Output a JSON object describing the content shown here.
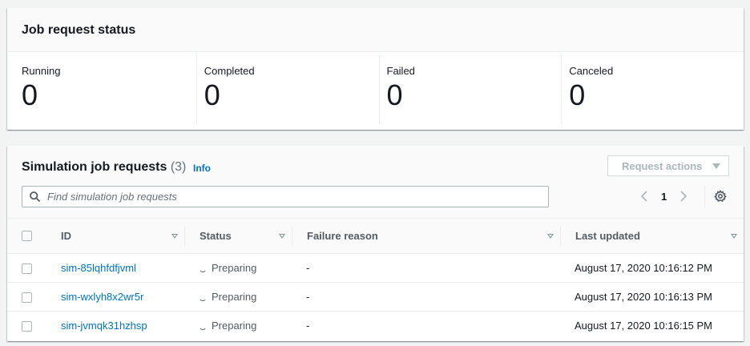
{
  "status_panel": {
    "title": "Job request status",
    "stats": [
      {
        "label": "Running",
        "value": "0"
      },
      {
        "label": "Completed",
        "value": "0"
      },
      {
        "label": "Failed",
        "value": "0"
      },
      {
        "label": "Canceled",
        "value": "0"
      }
    ]
  },
  "jobs_panel": {
    "title": "Simulation job requests",
    "count": "(3)",
    "info_link": "Info",
    "actions_button": "Request actions",
    "search_placeholder": "Find simulation job requests",
    "current_page": "1",
    "columns": [
      "ID",
      "Status",
      "Failure reason",
      "Last updated"
    ],
    "rows": [
      {
        "id": "sim-85lqhfdfjvml",
        "status": "Preparing",
        "failure_reason": "-",
        "last_updated": "August 17, 2020 10:16:12 PM"
      },
      {
        "id": "sim-wxlyh8x2wr5r",
        "status": "Preparing",
        "failure_reason": "-",
        "last_updated": "August 17, 2020 10:16:13 PM"
      },
      {
        "id": "sim-jvmqk31hzhsp",
        "status": "Preparing",
        "failure_reason": "-",
        "last_updated": "August 17, 2020 10:16:15 PM"
      }
    ]
  },
  "colors": {
    "link": "#0073bb",
    "background": "#f2f3f3",
    "border": "#eaeded"
  },
  "icons": [
    "search-icon",
    "chevron-left-icon",
    "chevron-right-icon",
    "gear-icon",
    "caret-down-icon",
    "sort-icon",
    "spinner-icon"
  ]
}
